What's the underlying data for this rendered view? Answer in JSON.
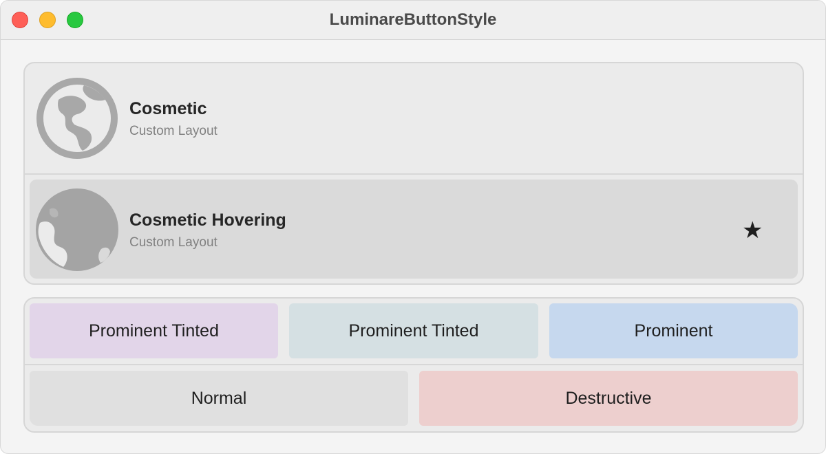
{
  "window": {
    "title": "LuminareButtonStyle",
    "traffic_lights": [
      "close",
      "minimize",
      "maximize"
    ]
  },
  "cosmetic_group": {
    "rows": [
      {
        "title": "Cosmetic",
        "subtitle": "Custom Layout",
        "icon": "globe-americas-icon",
        "hovering": false
      },
      {
        "title": "Cosmetic Hovering",
        "subtitle": "Custom Layout",
        "icon": "globe-europe-africa-icon",
        "hovering": true,
        "trailing_icon": "star-icon",
        "trailing_glyph": "★"
      }
    ]
  },
  "buttons_group": {
    "row1": [
      {
        "label": "Prominent Tinted",
        "color": "#e2d5e9"
      },
      {
        "label": "Prominent Tinted",
        "color": "#d5e0e3"
      },
      {
        "label": "Prominent",
        "color": "#c6d8ee"
      }
    ],
    "row2": [
      {
        "label": "Normal",
        "color": "#e0e0e0"
      },
      {
        "label": "Destructive",
        "color": "#edcfce"
      }
    ]
  }
}
